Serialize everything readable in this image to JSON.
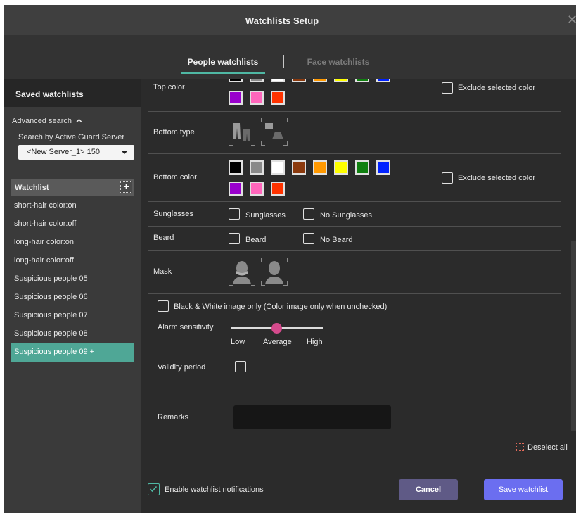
{
  "window": {
    "title": "Watchlists Setup",
    "close_glyph": "✕"
  },
  "tabs": [
    {
      "label": "People watchlists",
      "active": true
    },
    {
      "label": "Face watchlists",
      "active": false
    }
  ],
  "sidebar": {
    "heading": "Saved watchlists",
    "advanced_search_label": "Advanced search",
    "advanced_search_icon": "chevron-up-icon",
    "search_by_label": "Search by Active Guard Server",
    "server_select_value": "<New Server_1> 150",
    "watchlist_header": "Watchlist",
    "add_icon": "plus-icon",
    "items": [
      {
        "label": "short-hair color:on"
      },
      {
        "label": "short-hair color:off"
      },
      {
        "label": "long-hair color:on"
      },
      {
        "label": "long-hair color:off"
      },
      {
        "label": "Suspicious people 05"
      },
      {
        "label": "Suspicious people 06"
      },
      {
        "label": "Suspicious people 07"
      },
      {
        "label": "Suspicious people 08"
      },
      {
        "label": "Suspicious people 09 +",
        "selected": true
      }
    ]
  },
  "form": {
    "top_color": {
      "label": "Top color",
      "colors_row1": [
        "#000000",
        "#8a8a8a",
        "#ffffff",
        "#8b3a0e",
        "#ff9900",
        "#ffff00",
        "#108010",
        "#0022ff"
      ],
      "colors_row2": [
        "#9900cc",
        "#ff66bb",
        "#ff3300"
      ],
      "exclude_label": "Exclude selected color"
    },
    "bottom_type": {
      "label": "Bottom type",
      "icons": [
        "trousers-icon",
        "skirt-icon"
      ]
    },
    "bottom_color": {
      "label": "Bottom color",
      "colors_row1": [
        "#000000",
        "#8a8a8a",
        "#ffffff",
        "#8b3a0e",
        "#ff9900",
        "#ffff00",
        "#108010",
        "#0022ff"
      ],
      "colors_row2": [
        "#9900cc",
        "#ff66bb",
        "#ff3300"
      ],
      "exclude_label": "Exclude selected color"
    },
    "sunglasses": {
      "label": "Sunglasses",
      "option_yes": "Sunglasses",
      "option_no": "No Sunglasses"
    },
    "beard": {
      "label": "Beard",
      "option_yes": "Beard",
      "option_no": "No Beard"
    },
    "mask": {
      "label": "Mask",
      "icons": [
        "mask-face-icon",
        "mask-profile-icon"
      ]
    },
    "bw_only_label": "Black & White image only (Color image only when unchecked)",
    "alarm_sensitivity": {
      "label": "Alarm sensitivity",
      "low": "Low",
      "average": "Average",
      "high": "High",
      "value": "Average",
      "value_fraction": 0.5
    },
    "validity_period_label": "Validity period",
    "remarks_label": "Remarks",
    "remarks_value": "",
    "deselect_all_label": "Deselect all"
  },
  "footer": {
    "notifications_label": "Enable watchlist notifications",
    "notifications_checked": true,
    "cancel_label": "Cancel",
    "save_label": "Save watchlist"
  },
  "colors": {
    "accent": "#4fb8a4",
    "cancel": "#5f5a86",
    "save": "#6b6ef0",
    "slider_knob": "#d44a8c"
  }
}
